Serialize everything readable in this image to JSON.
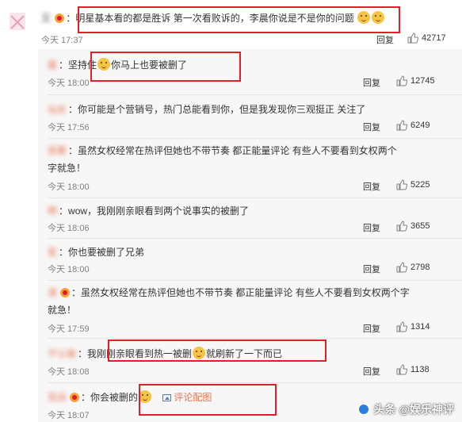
{
  "main": {
    "name": "又",
    "text": "明星基本看的都是胜诉 第一次看败诉的，李晨你说是不是你的问题",
    "time": "今天 17:37",
    "reply": "回复",
    "likes": "42717"
  },
  "replies": [
    {
      "name": "霙",
      "sep": "：",
      "text_a": "坚持住",
      "text_b": "你马上也要被删了",
      "time": "今天 18:00",
      "reply": "回复",
      "likes": "12745"
    },
    {
      "name": "仙女",
      "sep": "：",
      "text": "你可能是个营销号，热门总能看到你，但是我发现你三观挺正 关注了",
      "time": "今天 17:56",
      "reply": "回复",
      "likes": "6249"
    },
    {
      "name": "很累",
      "sep": "：",
      "text": "虽然女权经常在热评但她也不带节奏 都正能量评论 有些人不要看到女权两个",
      "text2": "字就急！",
      "time": "今天 18:00",
      "reply": "回复",
      "likes": "5225"
    },
    {
      "name": "啊",
      "sep": "：",
      "text": "wow，我刚刚亲眼看到两个说事实的被删了",
      "time": "今天 18:06",
      "reply": "回复",
      "likes": "3655"
    },
    {
      "name": "茗",
      "sep": "：",
      "text": "你也要被删了兄弟",
      "time": "今天 18:00",
      "reply": "回复",
      "likes": "2798"
    },
    {
      "name": "清",
      "sep": "：",
      "text": "虽然女权经常在热评但她也不带节奏 都正能量评论 有些人不要看到女权两个字",
      "text2": "就急！",
      "time": "今天 17:59",
      "reply": "回复",
      "likes": "1314"
    },
    {
      "name": "不认输",
      "sep": "：",
      "text_a": "我刚刚亲眼看到热一被删",
      "text_b": "就刷新了一下而已",
      "time": "今天 18:08",
      "reply": "回复",
      "likes": "1138"
    },
    {
      "name": "耳朵",
      "sep": "：",
      "text": "你会被删的",
      "pic": "评论配图",
      "time": "今天 18:07",
      "reply": "回复",
      "likes": ""
    }
  ],
  "watermark": "头条 @娱乐神评",
  "colors": {
    "highlight_box": "#e41e26",
    "username": "#eb7350",
    "reply_bg": "#f7f7f7"
  }
}
